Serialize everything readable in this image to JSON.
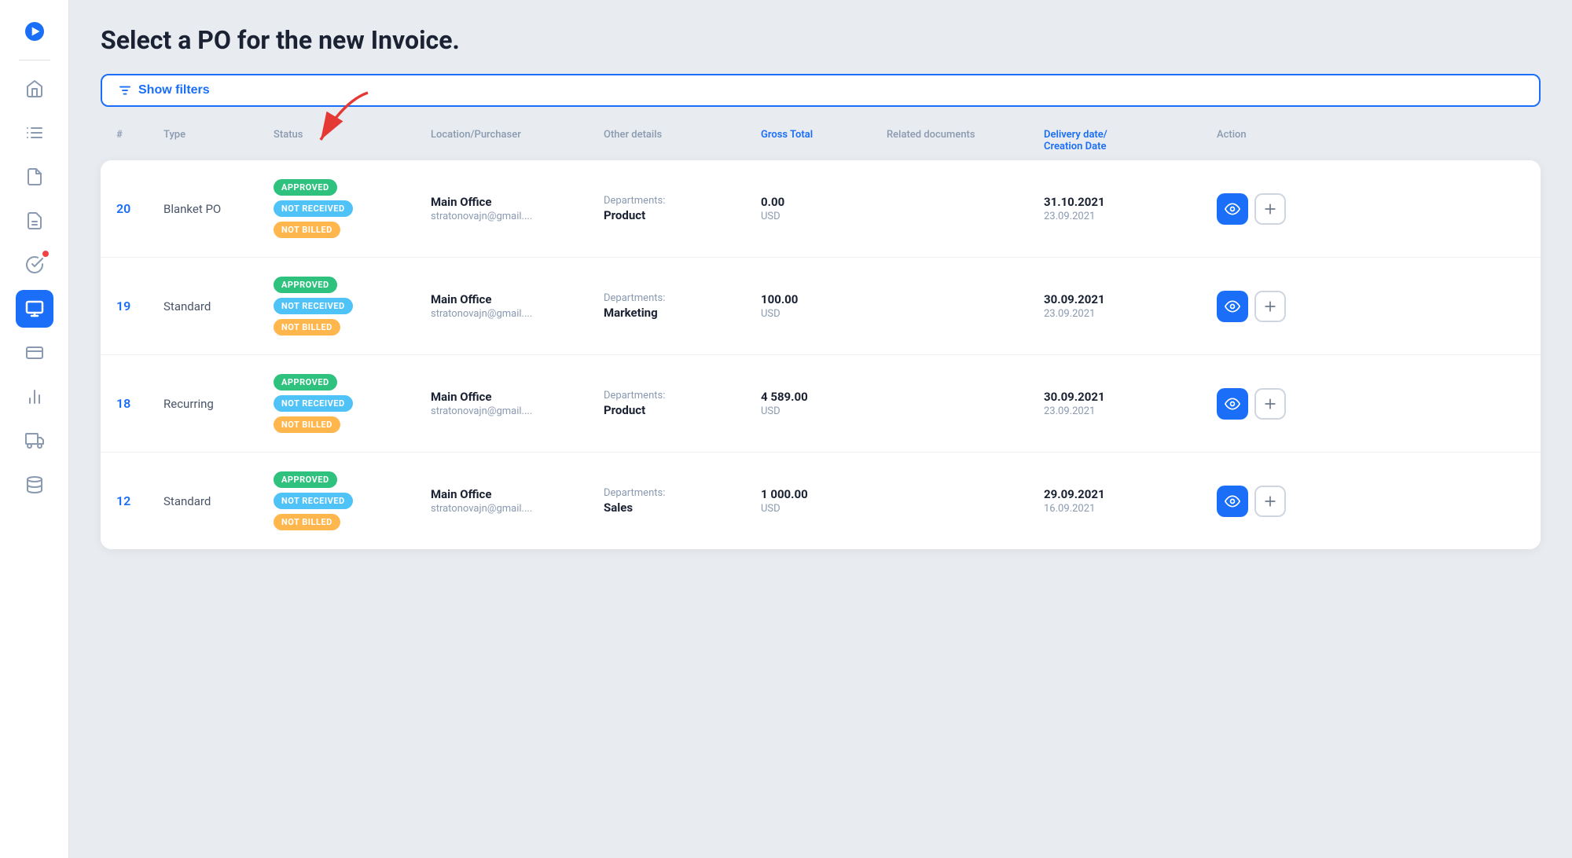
{
  "page": {
    "title": "Select a PO for the new Invoice."
  },
  "filters_button": {
    "label": "Show filters"
  },
  "table": {
    "columns": {
      "num": "#",
      "type": "Type",
      "status": "Status",
      "location": "Location/Purchaser",
      "other": "Other details",
      "gross": "Gross Total",
      "related": "Related documents",
      "delivery": "Delivery date/\nCreation Date",
      "action": "Action"
    },
    "rows": [
      {
        "num": "20",
        "type": "Blanket PO",
        "badges": [
          "APPROVED",
          "NOT RECEIVED",
          "NOT BILLED"
        ],
        "location_name": "Main Office",
        "location_email": "stratonovajn@gmail....",
        "detail_label": "Departments:",
        "detail_value": "Product",
        "gross_amount": "0.00",
        "gross_currency": "USD",
        "related": "",
        "date_primary": "31.10.2021",
        "date_secondary": "23.09.2021"
      },
      {
        "num": "19",
        "type": "Standard",
        "badges": [
          "APPROVED",
          "NOT RECEIVED",
          "NOT BILLED"
        ],
        "location_name": "Main Office",
        "location_email": "stratonovajn@gmail....",
        "detail_label": "Departments:",
        "detail_value": "Marketing",
        "gross_amount": "100.00",
        "gross_currency": "USD",
        "related": "",
        "date_primary": "30.09.2021",
        "date_secondary": "23.09.2021"
      },
      {
        "num": "18",
        "type": "Recurring",
        "badges": [
          "APPROVED",
          "NOT RECEIVED",
          "NOT BILLED"
        ],
        "location_name": "Main Office",
        "location_email": "stratonovajn@gmail....",
        "detail_label": "Departments:",
        "detail_value": "Product",
        "gross_amount": "4 589.00",
        "gross_currency": "USD",
        "related": "",
        "date_primary": "30.09.2021",
        "date_secondary": "23.09.2021"
      },
      {
        "num": "12",
        "type": "Standard",
        "badges": [
          "APPROVED",
          "NOT RECEIVED",
          "NOT BILLED"
        ],
        "location_name": "Main Office",
        "location_email": "stratonovajn@gmail....",
        "detail_label": "Departments:",
        "detail_value": "Sales",
        "gross_amount": "1 000.00",
        "gross_currency": "USD",
        "related": "",
        "date_primary": "29.09.2021",
        "date_secondary": "16.09.2021"
      }
    ]
  },
  "sidebar": {
    "items": [
      {
        "name": "home",
        "icon": "home"
      },
      {
        "name": "orders",
        "icon": "list"
      },
      {
        "name": "invoices",
        "icon": "document"
      },
      {
        "name": "reports",
        "icon": "document-text"
      },
      {
        "name": "approvals",
        "icon": "check-circle"
      },
      {
        "name": "purchase",
        "icon": "folder",
        "active": true
      },
      {
        "name": "payments",
        "icon": "credit-card"
      },
      {
        "name": "analytics",
        "icon": "bar-chart"
      },
      {
        "name": "delivery",
        "icon": "truck"
      },
      {
        "name": "integrations",
        "icon": "layers"
      }
    ]
  }
}
